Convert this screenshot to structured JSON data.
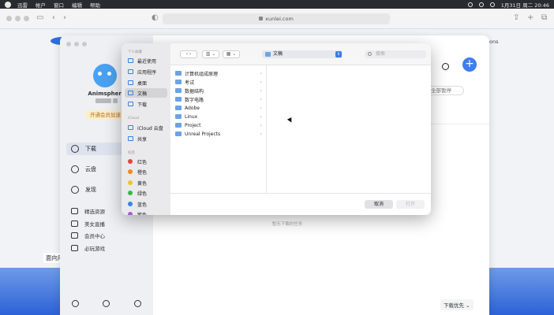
{
  "menubar": {
    "items": [
      "迅雷",
      "帐户",
      "窗口",
      "编辑",
      "帮助"
    ],
    "clock": "1月31日 周二  20:46"
  },
  "browser": {
    "url": "xunlei.com",
    "page_right_text": "ons",
    "page_left_caption": "面向用"
  },
  "app": {
    "username": "Animsphere",
    "vip_label": "开通会员加速",
    "nav_main": [
      "下载",
      "云盘",
      "发现"
    ],
    "nav_more": [
      "精选资源",
      "美女直播",
      "会员中心",
      "必玩游戏"
    ],
    "pause_label": "全部暂停",
    "empty_text": "暂无下载的任务",
    "priority_label": "下载优先 ⌄",
    "add_button": "+"
  },
  "dialog": {
    "sidebar": {
      "favorites_header": "个人收藏",
      "favorites": [
        "最近使用",
        "应用程序",
        "桌面",
        "文稿",
        "下载"
      ],
      "icloud_header": "iCloud",
      "icloud": [
        "iCloud 云盘",
        "共享"
      ],
      "tags_header": "标签",
      "tags": [
        {
          "label": "红色",
          "color": "#e0463c"
        },
        {
          "label": "橙色",
          "color": "#f08a24"
        },
        {
          "label": "黄色",
          "color": "#f2c12e"
        },
        {
          "label": "绿色",
          "color": "#3cb64a"
        },
        {
          "label": "蓝色",
          "color": "#3a82e6"
        },
        {
          "label": "紫色",
          "color": "#a45ccf"
        }
      ]
    },
    "location": "文稿",
    "search_placeholder": "搜索",
    "folders": [
      "计算机组成原理",
      "考试",
      "数据结构",
      "数字电路",
      "Adobe",
      "Linux",
      "Project",
      "Unreal Projects"
    ],
    "cancel_label": "取消",
    "open_label": "打开"
  }
}
